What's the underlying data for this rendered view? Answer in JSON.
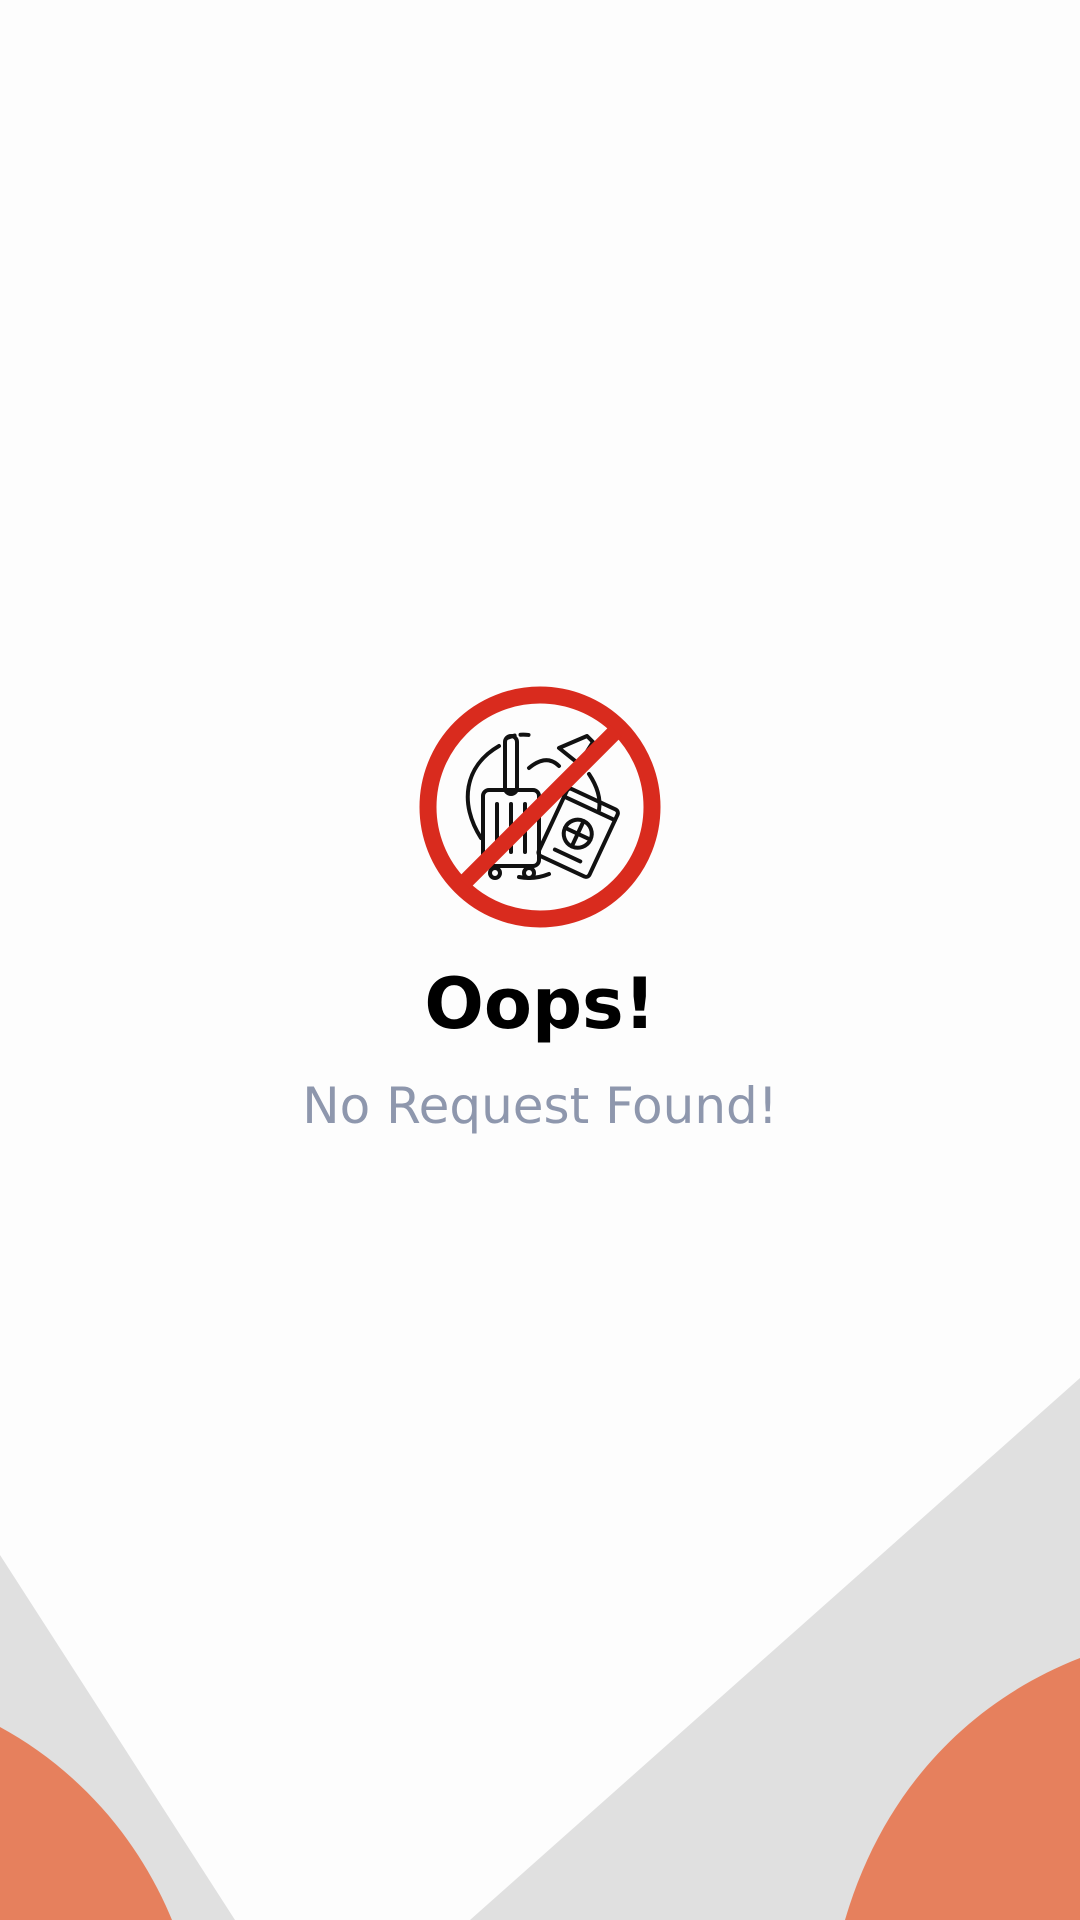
{
  "empty_state": {
    "icon": "no-travel-icon",
    "title": "Oops!",
    "message": "No Request Found!"
  },
  "colors": {
    "background": "#fdfdfd",
    "decor_gray": "#e0e0e0",
    "decor_orange": "#e6805d",
    "prohibit_red": "#d92b1e",
    "title": "#000000",
    "message": "#8e97ad"
  }
}
